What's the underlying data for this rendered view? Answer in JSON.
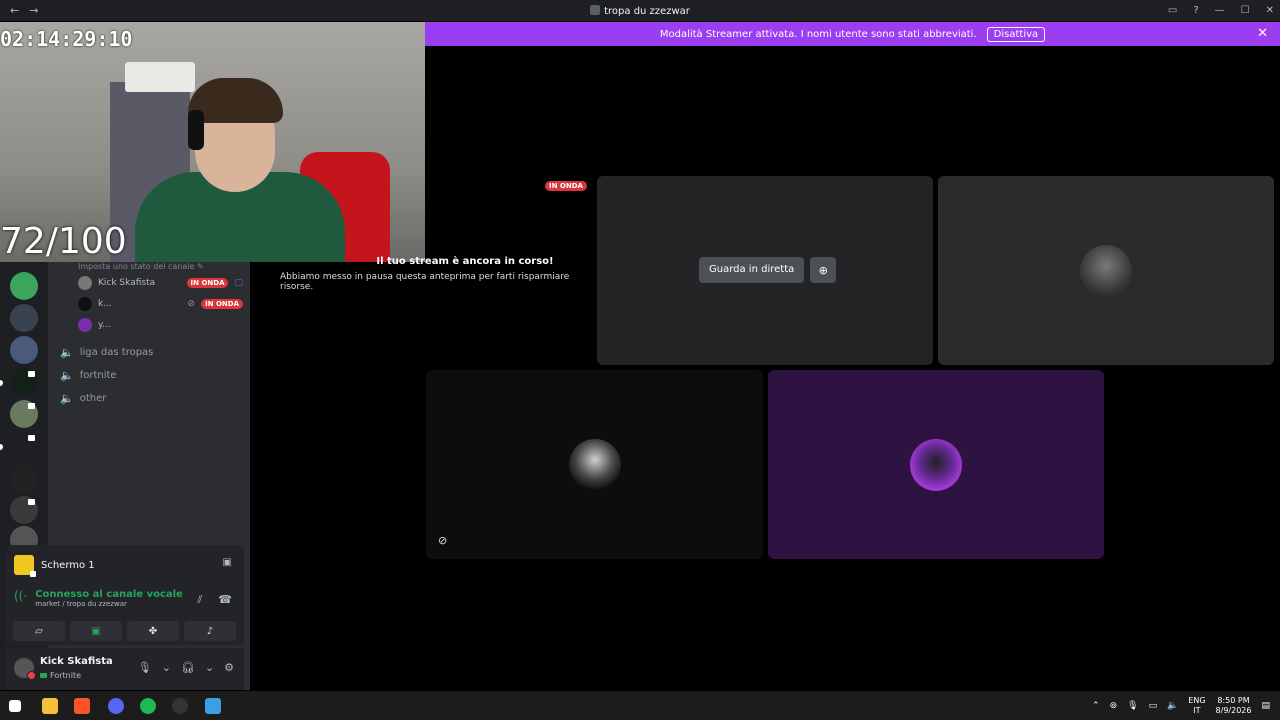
{
  "window": {
    "title": "tropa du zzezwar",
    "nav_back": "←",
    "nav_forward": "→",
    "inbox_icon": "inbox-icon",
    "help_icon": "?",
    "minimize": "—",
    "maximize": "☐",
    "close": "✕"
  },
  "banner": {
    "text": "Modalità Streamer attivata. I nomi utente sono stati abbreviati.",
    "button": "Disattiva",
    "close": "✕",
    "color": "#9b3ef1"
  },
  "overlay": {
    "timer": "02:14:29:10",
    "counter": "72/100"
  },
  "channels": {
    "top_text": "Imposta uno stato del canale ✎",
    "members": [
      {
        "name": "Kick Skafista",
        "live": "IN ONDA",
        "extra": "▢"
      },
      {
        "name": "k...",
        "live": "IN ONDA",
        "extra": ""
      },
      {
        "name": "y...",
        "live": "",
        "extra": ""
      }
    ],
    "voice_channels": [
      "liga das tropas",
      "fortnite",
      "other"
    ]
  },
  "voice_panel": {
    "screen_label": "Schermo 1",
    "status": "Connesso al canale vocale",
    "location": "market / tropa du zzezwar"
  },
  "user": {
    "name": "Kick Skafista",
    "activity": "Fortnite"
  },
  "stage": {
    "live_badge": "IN ONDA",
    "paused_title": "Il tuo stream è ancora in corso!",
    "paused_desc": "Abbiamo messo in pausa questa anteprima per farti risparmiare risorse.",
    "watch_button": "Guarda in diretta"
  },
  "taskbar": {
    "lang_line1": "ENG",
    "lang_line2": "IT",
    "time": "8:50 PM",
    "date": "8/9/2026"
  },
  "colors": {
    "live": "#da373c",
    "connected": "#23a55a",
    "purple_tile": "#2d1242"
  }
}
